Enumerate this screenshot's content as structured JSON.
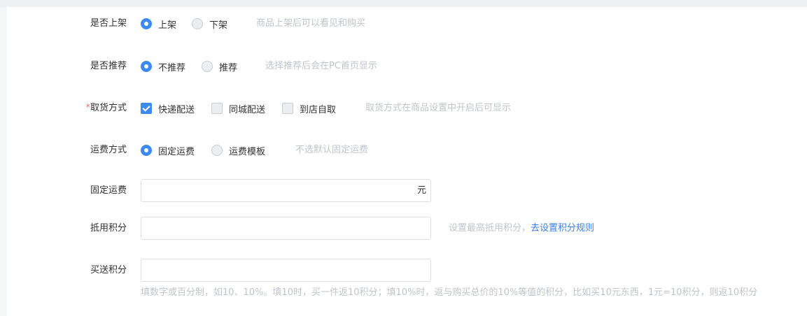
{
  "form": {
    "listing": {
      "label": "是否上架",
      "options": [
        "上架",
        "下架"
      ],
      "selected": "上架",
      "hint": "商品上架后可以看见和购买"
    },
    "recommend": {
      "label": "是否推荐",
      "options": [
        "不推荐",
        "推荐"
      ],
      "selected": "不推荐",
      "hint": "选择推荐后会在PC首页显示"
    },
    "pickup": {
      "required_mark": "*",
      "label": "取货方式",
      "options": [
        "快递配送",
        "同城配送",
        "到店自取"
      ],
      "checked": [
        "快递配送"
      ],
      "hint": "取货方式在商品设置中开启后可显示"
    },
    "shipping_method": {
      "label": "运费方式",
      "options": [
        "固定运费",
        "运费模板"
      ],
      "selected": "固定运费",
      "hint": "不选默认固定运费"
    },
    "fixed_shipping": {
      "label": "固定运费",
      "value": "",
      "suffix": "元"
    },
    "points_deduct": {
      "label": "抵用积分",
      "value": "",
      "hint": "设置最高抵用积分，",
      "link": "去设置积分规则"
    },
    "points_gift": {
      "label": "买送积分",
      "value": "",
      "note": "填数字或百分制，如10、10%。填10时，买一件返10积分；填10%时，返与购买总价的10%等值的积分，比如买10元东西，1元=10积分，则返10积分"
    }
  },
  "colors": {
    "accent": "#3d8af7",
    "link": "#3d7ee8",
    "hint": "#c0c4cc",
    "required": "#f56c6c"
  }
}
